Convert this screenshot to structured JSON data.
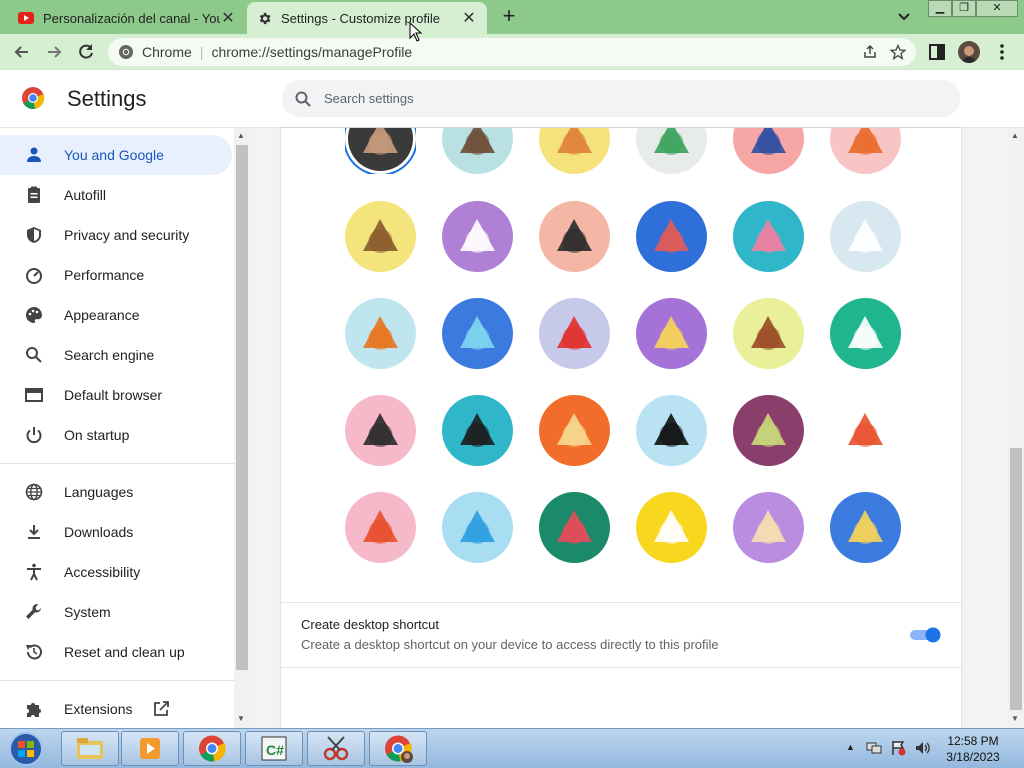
{
  "tabs": [
    {
      "title": "Personalización del canal - YouTube",
      "icon": "youtube-icon"
    },
    {
      "title": "Settings - Customize profile",
      "icon": "gear-icon"
    }
  ],
  "omnibox": {
    "site": "Chrome",
    "url": "chrome://settings/manageProfile"
  },
  "header": {
    "title": "Settings",
    "search_placeholder": "Search settings"
  },
  "sidebar": {
    "items": [
      {
        "label": "You and Google",
        "icon": "person-icon",
        "selected": true
      },
      {
        "label": "Autofill",
        "icon": "clipboard-icon"
      },
      {
        "label": "Privacy and security",
        "icon": "shield-icon"
      },
      {
        "label": "Performance",
        "icon": "speedometer-icon"
      },
      {
        "label": "Appearance",
        "icon": "palette-icon"
      },
      {
        "label": "Search engine",
        "icon": "search-icon"
      },
      {
        "label": "Default browser",
        "icon": "browser-window-icon"
      },
      {
        "label": "On startup",
        "icon": "power-icon"
      },
      {
        "label": "Languages",
        "icon": "globe-icon"
      },
      {
        "label": "Downloads",
        "icon": "download-icon"
      },
      {
        "label": "Accessibility",
        "icon": "accessibility-icon"
      },
      {
        "label": "System",
        "icon": "wrench-icon"
      },
      {
        "label": "Reset and clean up",
        "icon": "reset-icon"
      },
      {
        "label": "Extensions",
        "icon": "puzzle-icon"
      }
    ]
  },
  "avatars": [
    {
      "name": "user-photo-avatar",
      "bg": "#3a3a3a",
      "fg": "#c99b7b",
      "selected": true
    },
    {
      "name": "origami-cat-avatar",
      "bg": "#b9e1e3",
      "fg": "#6b4c36"
    },
    {
      "name": "origami-fox-avatar",
      "bg": "#f5e27a",
      "fg": "#e0833a"
    },
    {
      "name": "origami-dragon-avatar",
      "bg": "#e8ece8",
      "fg": "#3da35d"
    },
    {
      "name": "origami-elephant-avatar",
      "bg": "#f7a6a6",
      "fg": "#2b4fa3"
    },
    {
      "name": "origami-squirrel-avatar",
      "bg": "#f8c4c4",
      "fg": "#e86b2b"
    },
    {
      "name": "origami-monkey-avatar",
      "bg": "#f3e57c",
      "fg": "#8b5a2b"
    },
    {
      "name": "origami-panda-avatar",
      "bg": "#b07fd6",
      "fg": "#ffffff"
    },
    {
      "name": "origami-penguin-avatar",
      "bg": "#f5b7a5",
      "fg": "#2b2b2b"
    },
    {
      "name": "origami-butterfly-avatar",
      "bg": "#2f6fd9",
      "fg": "#e35b56"
    },
    {
      "name": "origami-rabbit-avatar",
      "bg": "#2fb7c9",
      "fg": "#f07fa2"
    },
    {
      "name": "origami-unicorn-avatar",
      "bg": "#d8e8f0",
      "fg": "#ffffff"
    },
    {
      "name": "basketball-avatar",
      "bg": "#bfe6ee",
      "fg": "#e8731f"
    },
    {
      "name": "bike-avatar",
      "bg": "#3b7be0",
      "fg": "#7fd6f0"
    },
    {
      "name": "bird-avatar",
      "bg": "#c7c9ea",
      "fg": "#e0302b"
    },
    {
      "name": "cheese-avatar",
      "bg": "#a572d8",
      "fg": "#f6d35a"
    },
    {
      "name": "football-avatar",
      "bg": "#eaf09a",
      "fg": "#9b4b27"
    },
    {
      "name": "burger-avatar",
      "bg": "#1fb58e",
      "fg": "#ffffff"
    },
    {
      "name": "sunglasses-avatar",
      "bg": "#f6b9c9",
      "fg": "#2b2b2b"
    },
    {
      "name": "sushi-avatar",
      "bg": "#2fb7c9",
      "fg": "#1e1e1e"
    },
    {
      "name": "tamagotchi-avatar",
      "bg": "#f26c2b",
      "fg": "#f5d890"
    },
    {
      "name": "vinyl-avatar",
      "bg": "#b9e3f3",
      "fg": "#111111"
    },
    {
      "name": "avocado-avatar",
      "bg": "#8a3e6b",
      "fg": "#c9d97a"
    },
    {
      "name": "smiley-avatar",
      "bg": "#ffffff",
      "fg": "#e8502b"
    },
    {
      "name": "ice-cream-avatar",
      "bg": "#f6b9c9",
      "fg": "#e8502b"
    },
    {
      "name": "ice-cubes-avatar",
      "bg": "#a8ddf2",
      "fg": "#2b9fe0"
    },
    {
      "name": "watermelon-avatar",
      "bg": "#1a8a6b",
      "fg": "#e84b5a"
    },
    {
      "name": "onigiri-avatar",
      "bg": "#f8d81e",
      "fg": "#ffffff"
    },
    {
      "name": "pizza-avatar",
      "bg": "#b98de0",
      "fg": "#f6e0b0"
    },
    {
      "name": "sandwich-avatar",
      "bg": "#3b7be0",
      "fg": "#f6d35a"
    }
  ],
  "shortcut": {
    "title": "Create desktop shortcut",
    "subtitle": "Create a desktop shortcut on your device to access directly to this profile",
    "enabled": true
  },
  "taskbar": {
    "time": "12:58 PM",
    "date": "3/18/2023",
    "apps": [
      "start-button",
      "file-explorer-icon",
      "media-player-icon",
      "chrome-icon",
      "csharp-editor-icon",
      "scissors-tool-icon",
      "chrome-profile-icon"
    ]
  },
  "colors": {
    "accent": "#1a73e8",
    "tabstrip": "#8dc98a",
    "toolbar": "#d6efd2"
  }
}
